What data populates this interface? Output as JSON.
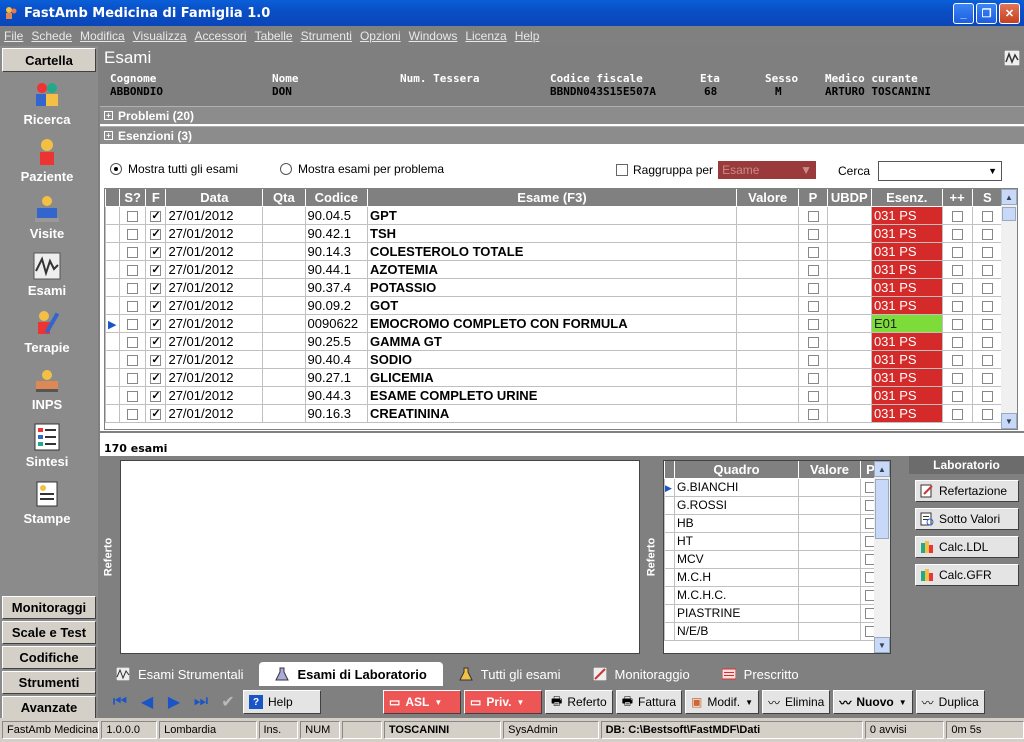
{
  "window": {
    "title": "FastAmb Medicina di Famiglia 1.0"
  },
  "menu": [
    "File",
    "Schede",
    "Modifica",
    "Visualizza",
    "Accessori",
    "Tabelle",
    "Strumenti",
    "Opzioni",
    "Windows",
    "Licenza",
    "Help"
  ],
  "nav": {
    "header": "Cartella",
    "items": [
      {
        "label": "Ricerca",
        "icon": "search-people-icon"
      },
      {
        "label": "Paziente",
        "icon": "patient-icon"
      },
      {
        "label": "Visite",
        "icon": "visit-icon"
      },
      {
        "label": "Esami",
        "icon": "exam-chart-icon"
      },
      {
        "label": "Terapie",
        "icon": "therapy-icon"
      },
      {
        "label": "INPS",
        "icon": "inps-icon"
      },
      {
        "label": "Sintesi",
        "icon": "summary-icon"
      },
      {
        "label": "Stampe",
        "icon": "print-icon"
      }
    ],
    "bottom": [
      "Monitoraggi",
      "Scale e Test",
      "Codifiche",
      "Strumenti",
      "Avanzate"
    ]
  },
  "page": {
    "title": "Esami"
  },
  "patient": {
    "cognome_label": "Cognome",
    "cognome": "ABBONDIO",
    "nome_label": "Nome",
    "nome": "DON",
    "tessera_label": "Num. Tessera",
    "tessera": "",
    "cf_label": "Codice fiscale",
    "cf": "BBNDN043S15E507A",
    "eta_label": "Eta",
    "eta": "68",
    "sesso_label": "Sesso",
    "sesso": "M",
    "medico_label": "Medico curante",
    "medico": "ARTURO TOSCANINI"
  },
  "sections": {
    "problemi": "Problemi (20)",
    "esenzioni": "Esenzioni (3)"
  },
  "filters": {
    "radio_all": "Mostra tutti gli esami",
    "radio_problem": "Mostra esami per problema",
    "group_label": "Raggruppa per",
    "group_value": "Esame",
    "search_label": "Cerca",
    "search_value": ""
  },
  "grid": {
    "columns": [
      "S?",
      "F",
      "Data",
      "Qta",
      "Codice",
      "Esame (F3)",
      "Valore",
      "P",
      "UBDP",
      "Esenz.",
      "++",
      "S"
    ],
    "rows": [
      {
        "s": false,
        "f": true,
        "data": "27/01/2012",
        "qta": "",
        "codice": "90.04.5",
        "esame": "GPT",
        "valore": "",
        "esenz": "031 PS",
        "green": false,
        "current": false
      },
      {
        "s": false,
        "f": true,
        "data": "27/01/2012",
        "qta": "",
        "codice": "90.42.1",
        "esame": "TSH",
        "valore": "",
        "esenz": "031 PS",
        "green": false,
        "current": false
      },
      {
        "s": false,
        "f": true,
        "data": "27/01/2012",
        "qta": "",
        "codice": "90.14.3",
        "esame": "COLESTEROLO TOTALE",
        "valore": "",
        "esenz": "031 PS",
        "green": false,
        "current": false
      },
      {
        "s": false,
        "f": true,
        "data": "27/01/2012",
        "qta": "",
        "codice": "90.44.1",
        "esame": "AZOTEMIA",
        "valore": "",
        "esenz": "031 PS",
        "green": false,
        "current": false
      },
      {
        "s": false,
        "f": true,
        "data": "27/01/2012",
        "qta": "",
        "codice": "90.37.4",
        "esame": "POTASSIO",
        "valore": "",
        "esenz": "031 PS",
        "green": false,
        "current": false
      },
      {
        "s": false,
        "f": true,
        "data": "27/01/2012",
        "qta": "",
        "codice": "90.09.2",
        "esame": "GOT",
        "valore": "",
        "esenz": "031 PS",
        "green": false,
        "current": false
      },
      {
        "s": false,
        "f": true,
        "data": "27/01/2012",
        "qta": "",
        "codice": "0090622",
        "esame": "EMOCROMO COMPLETO CON FORMULA",
        "valore": "",
        "esenz": "E01",
        "green": true,
        "current": true
      },
      {
        "s": false,
        "f": true,
        "data": "27/01/2012",
        "qta": "",
        "codice": "90.25.5",
        "esame": "GAMMA GT",
        "valore": "",
        "esenz": "031 PS",
        "green": false,
        "current": false
      },
      {
        "s": false,
        "f": true,
        "data": "27/01/2012",
        "qta": "",
        "codice": "90.40.4",
        "esame": "SODIO",
        "valore": "",
        "esenz": "031 PS",
        "green": false,
        "current": false
      },
      {
        "s": false,
        "f": true,
        "data": "27/01/2012",
        "qta": "",
        "codice": "90.27.1",
        "esame": "GLICEMIA",
        "valore": "",
        "esenz": "031 PS",
        "green": false,
        "current": false
      },
      {
        "s": false,
        "f": true,
        "data": "27/01/2012",
        "qta": "",
        "codice": "90.44.3",
        "esame": "ESAME COMPLETO URINE",
        "valore": "",
        "esenz": "031 PS",
        "green": false,
        "current": false
      },
      {
        "s": false,
        "f": true,
        "data": "27/01/2012",
        "qta": "",
        "codice": "90.16.3",
        "esame": "CREATININA",
        "valore": "",
        "esenz": "031 PS",
        "green": false,
        "current": false
      }
    ]
  },
  "count": "170 esami",
  "referto_label": "Referto",
  "quadro": {
    "columns": [
      "Quadro",
      "Valore",
      "P"
    ],
    "rows": [
      "G.BIANCHI",
      "G.ROSSI",
      "HB",
      "HT",
      "MCV",
      "M.C.H",
      "M.C.H.C.",
      "PIASTRINE",
      "N/E/B"
    ]
  },
  "lab": {
    "title": "Laboratorio",
    "buttons": [
      "Refertazione",
      "Sotto Valori",
      "Calc.LDL",
      "Calc.GFR"
    ]
  },
  "tabs": [
    "Esami Strumentali",
    "Esami di Laboratorio",
    "Tutti gli esami",
    "Monitoraggio",
    "Prescritto"
  ],
  "toolbar": {
    "help": "Help",
    "asl": "ASL",
    "priv": "Priv.",
    "referto": "Referto",
    "fattura": "Fattura",
    "modif": "Modif.",
    "elimina": "Elimina",
    "nuovo": "Nuovo",
    "duplica": "Duplica"
  },
  "status": [
    "FastAmb Medicina",
    "1.0.0.0",
    "Lombardia",
    "Ins.",
    "NUM",
    "",
    "TOSCANINI",
    "SysAdmin",
    "DB: C:\\Bestsoft\\FastMDF\\Dati",
    "0 avvisi",
    "0m 5s"
  ],
  "colors": {
    "esenz_red": "#d42a2a",
    "esenz_green": "#7ddc3a",
    "title_blue": "#0a5fd8"
  }
}
